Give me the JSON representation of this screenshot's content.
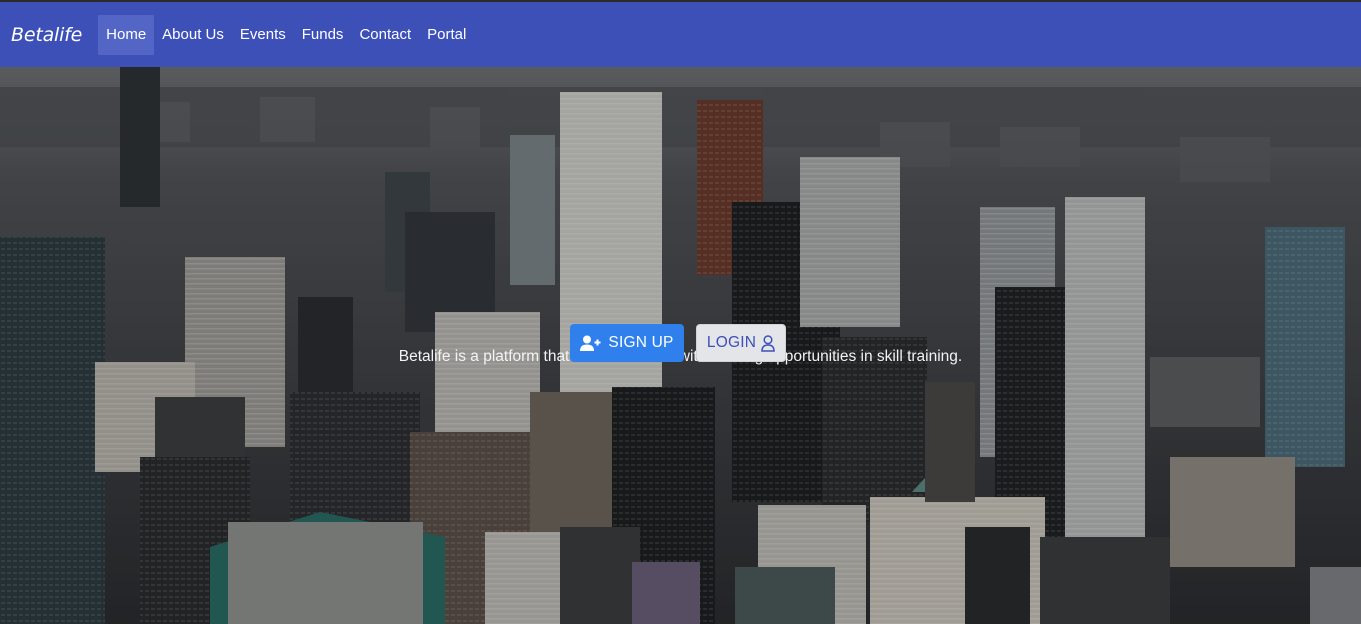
{
  "nav": {
    "brand": "Betalife",
    "items": [
      {
        "label": "Home",
        "active": true
      },
      {
        "label": "About Us"
      },
      {
        "label": "Events"
      },
      {
        "label": "Funds"
      },
      {
        "label": "Contact"
      },
      {
        "label": "Portal"
      }
    ]
  },
  "hero": {
    "tagline": "Betalife is a platform that matches users with existing opportunities in skill training.",
    "signup_label": "SIGN UP",
    "signup_icon": "user-plus-icon",
    "login_label": "LOGIN",
    "login_icon": "user-icon",
    "background": "aerial-city-skyline-image"
  },
  "colors": {
    "navbar": "#3d50b8",
    "active_tab": "#5466c5",
    "signup_button": "#2f80ed",
    "login_button": "#e3e5e8"
  }
}
